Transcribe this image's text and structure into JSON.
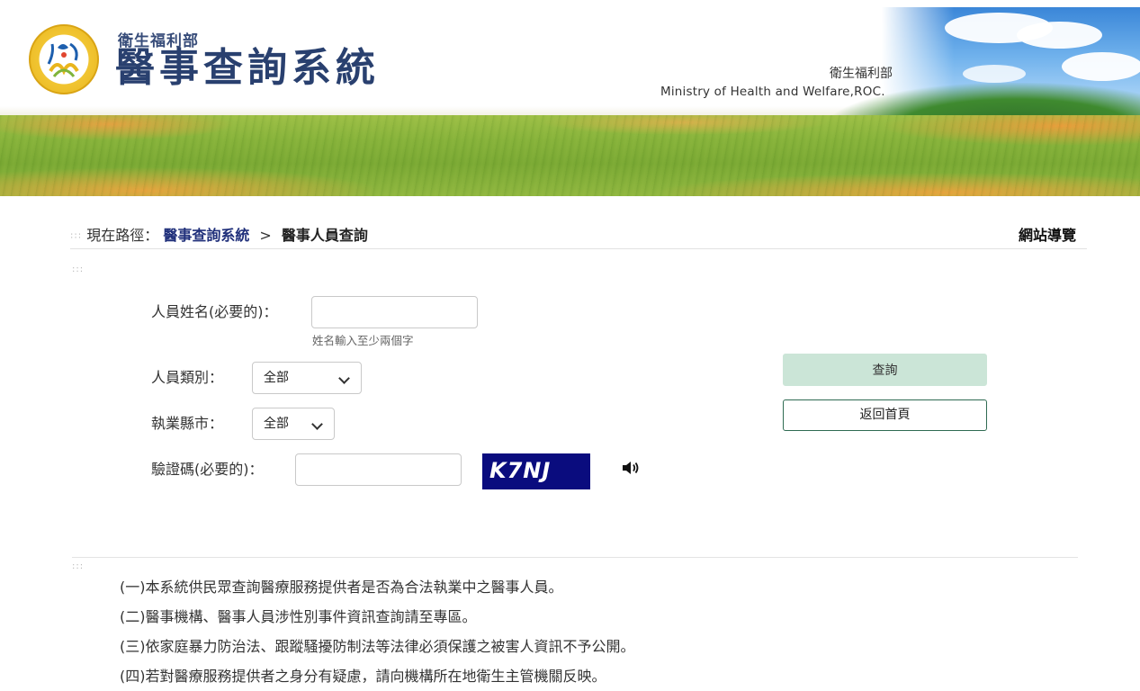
{
  "header": {
    "ministry_small": "衛生福利部",
    "system_title": "醫事查詢系統",
    "banner_ministry_zh": "衛生福利部",
    "banner_ministry_en": "Ministry of Health and Welfare,ROC."
  },
  "breadcrumb": {
    "label": "現在路徑：",
    "home": "醫事查詢系統",
    "separator": ">",
    "current": "醫事人員查詢",
    "sitemap": "網站導覽"
  },
  "form": {
    "name_label": "人員姓名(必要的)：",
    "name_value": "",
    "name_hint": "姓名輸入至少兩個字",
    "category_label": "人員類別：",
    "category_selected": "全部",
    "city_label": "執業縣市：",
    "city_selected": "全部",
    "captcha_label": "驗證碼(必要的)：",
    "captcha_value": "",
    "captcha_text": "K7NJ"
  },
  "buttons": {
    "query": "查詢",
    "home": "返回首頁"
  },
  "notes": [
    "(一)本系統供民眾查詢醫療服務提供者是否為合法執業中之醫事人員。",
    "(二)醫事機構、醫事人員涉性別事件資訊查詢請至專區。",
    "(三)依家庭暴力防治法、跟蹤騷擾防制法等法律必須保護之被害人資訊不予公開。",
    "(四)若對醫療服務提供者之身分有疑慮，請向機構所在地衛生主管機關反映。"
  ],
  "colors": {
    "title_navy": "#29406f",
    "link_navy": "#1f2f7a",
    "captcha_bg": "#0a0c7e",
    "query_button_bg": "#cbe5d7",
    "home_button_border": "#2f6b52"
  },
  "icons": {
    "logo": "ministry-emblem-icon",
    "audio": "speaker-icon",
    "dropdown": "chevron-down-icon"
  }
}
